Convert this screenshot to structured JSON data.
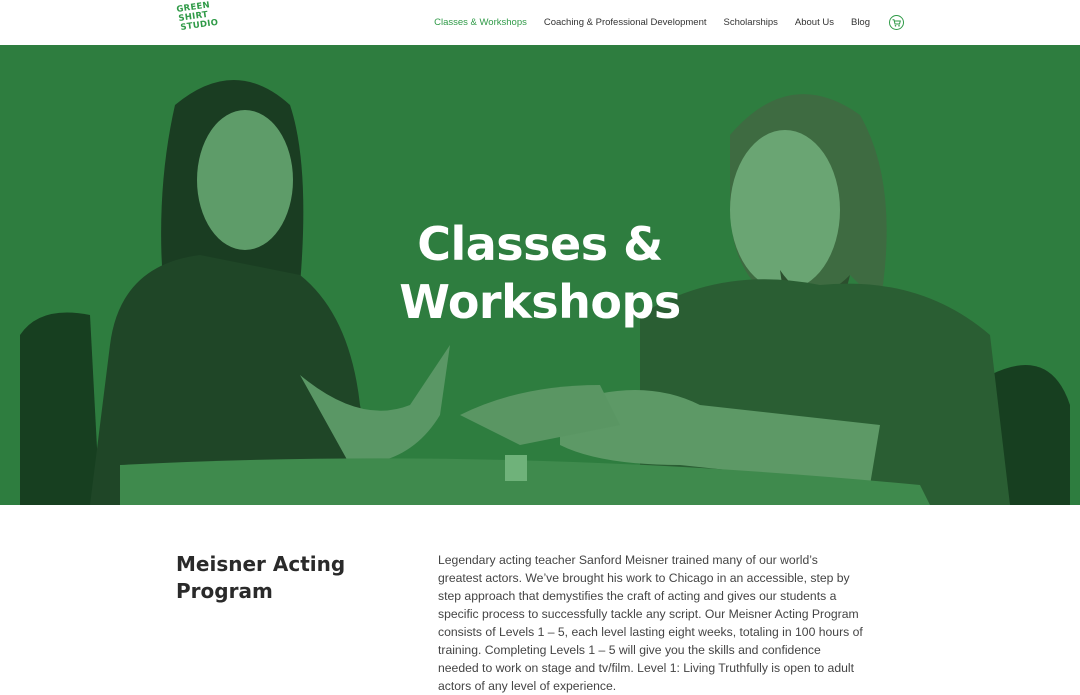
{
  "logo": {
    "lines": [
      "GREEN",
      "SHIRT",
      "STUDIO"
    ]
  },
  "nav": {
    "items": [
      {
        "label": "Classes & Workshops",
        "active": true
      },
      {
        "label": "Coaching & Professional Development",
        "active": false
      },
      {
        "label": "Scholarships",
        "active": false
      },
      {
        "label": "About Us",
        "active": false
      },
      {
        "label": "Blog",
        "active": false
      }
    ],
    "cart_icon": "cart-icon"
  },
  "hero": {
    "title_line1": "Classes &",
    "title_line2": "Workshops"
  },
  "section": {
    "heading_line1": "Meisner Acting",
    "heading_line2": "Program",
    "body": "Legendary acting teacher Sanford Meisner trained many of our world’s greatest actors. We’ve brought his work to Chicago in an accessible, step by step approach that demystifies the craft of acting and gives our students a specific process to successfully tackle any script. Our Meisner Acting Program consists of Levels 1 – 5, each level lasting eight weeks, totaling in 100 hours of training. Completing Levels 1 – 5 will give you the skills and confidence needed to work on stage and tv/film. Level 1: Living Truthfully is open to adult actors of any level of experience."
  },
  "colors": {
    "brand_green": "#2f9a47",
    "hero_overlay": "#2c7a3e",
    "text_dark": "#2a2a2a"
  }
}
